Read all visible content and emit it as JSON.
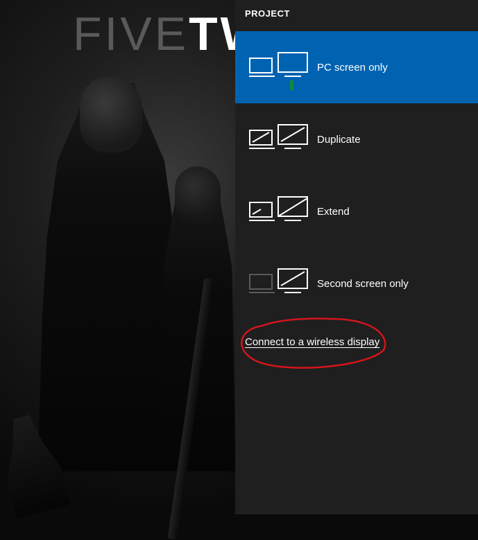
{
  "wallpaper": {
    "line": "FIVETWI",
    "thin": "FIVE",
    "bold": "TWI"
  },
  "panel": {
    "title": "PROJECT",
    "options": [
      {
        "label": "PC screen only"
      },
      {
        "label": "Duplicate"
      },
      {
        "label": "Extend"
      },
      {
        "label": "Second screen only"
      }
    ],
    "wireless_link": "Connect to a wireless display"
  }
}
